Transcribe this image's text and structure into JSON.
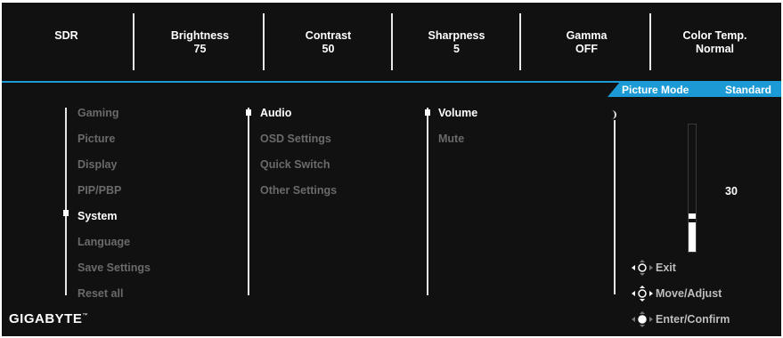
{
  "status_bar": [
    {
      "label": "SDR",
      "value": ""
    },
    {
      "label": "Brightness",
      "value": "75"
    },
    {
      "label": "Contrast",
      "value": "50"
    },
    {
      "label": "Sharpness",
      "value": "5"
    },
    {
      "label": "Gamma",
      "value": "OFF"
    },
    {
      "label": "Color Temp.",
      "value": "Normal"
    }
  ],
  "picture_mode": {
    "label": "Picture Mode",
    "value": "Standard"
  },
  "main_menu": {
    "items": [
      "Gaming",
      "Picture",
      "Display",
      "PIP/PBP",
      "System",
      "Language",
      "Save Settings",
      "Reset all"
    ],
    "selected": "System"
  },
  "system_menu": {
    "items": [
      "Audio",
      "OSD Settings",
      "Quick Switch",
      "Other Settings"
    ],
    "selected": "Audio"
  },
  "audio_menu": {
    "items": [
      "Volume",
      "Mute"
    ],
    "selected": "Volume"
  },
  "volume": {
    "value": "30",
    "level": 0.3
  },
  "hints": [
    {
      "icon": "joystick-left-icon",
      "label": "Exit"
    },
    {
      "icon": "joystick-all-directions-icon",
      "label": "Move/Adjust"
    },
    {
      "icon": "joystick-press-icon",
      "label": "Enter/Confirm"
    }
  ],
  "brand": {
    "logo": "GIGABYTE",
    "trademark": "™"
  },
  "colors": {
    "background": "#111111",
    "accent": "#1b9ad6",
    "active": "#ffffff",
    "inactive": "#6a6a6a"
  }
}
